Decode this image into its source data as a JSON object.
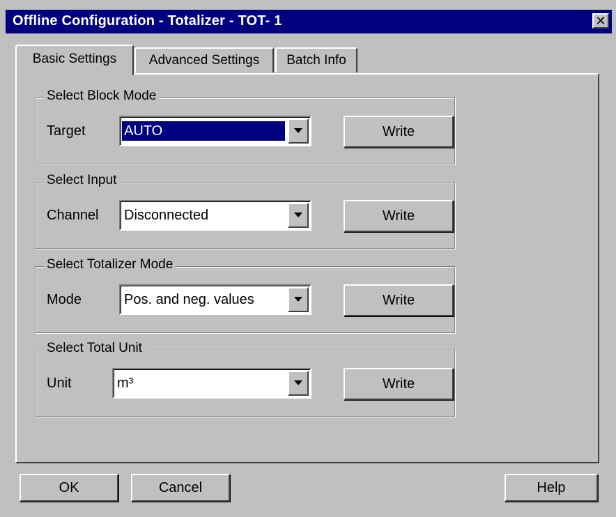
{
  "window": {
    "title": "Offline Configuration - Totalizer - TOT- 1",
    "close_glyph": "✕"
  },
  "tabs": [
    {
      "label": "Basic Settings",
      "active": true
    },
    {
      "label": "Advanced Settings",
      "active": false
    },
    {
      "label": "Batch Info",
      "active": false
    }
  ],
  "groups": {
    "block_mode": {
      "title": "Select Block Mode",
      "label": "Target",
      "value": "AUTO",
      "button": "Write"
    },
    "input": {
      "title": "Select Input",
      "label": "Channel",
      "value": "Disconnected",
      "button": "Write"
    },
    "totalizer_mode": {
      "title": "Select Totalizer Mode",
      "label": "Mode",
      "value": "Pos. and neg. values",
      "button": "Write"
    },
    "total_unit": {
      "title": "Select Total Unit",
      "label": "Unit",
      "value": "m³",
      "button": "Write"
    }
  },
  "buttons": {
    "ok": "OK",
    "cancel": "Cancel",
    "help": "Help"
  },
  "colors": {
    "titlebar": "#000080",
    "face": "#c0c0c0",
    "selection": "#000080"
  }
}
